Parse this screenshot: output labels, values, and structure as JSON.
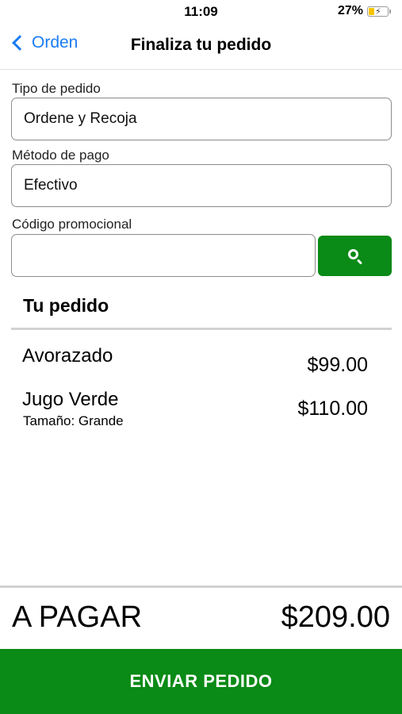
{
  "status_bar": {
    "time": "11:09",
    "battery_percent": "27%",
    "battery_color": "#f5c400"
  },
  "nav": {
    "back_label": "Orden",
    "title": "Finaliza tu pedido",
    "back_icon": "chevron-left-icon",
    "accent_color": "#1a7cf2"
  },
  "form": {
    "order_type": {
      "label": "Tipo de pedido",
      "value": "Ordene y Recoja"
    },
    "payment_method": {
      "label": "Método de pago",
      "value": "Efectivo"
    },
    "promo_code": {
      "label": "Código promocional",
      "value": "",
      "button_icon": "search-icon"
    }
  },
  "order": {
    "title": "Tu pedido",
    "items": [
      {
        "name": "Avorazado",
        "detail": "",
        "price": "$99.00"
      },
      {
        "name": "Jugo Verde",
        "detail": "Tamaño: Grande",
        "price": "$110.00"
      }
    ]
  },
  "footer": {
    "total_label": "A PAGAR",
    "total_value": "$209.00",
    "submit_label": "ENVIAR PEDIDO",
    "brand_color": "#0a8a16"
  }
}
